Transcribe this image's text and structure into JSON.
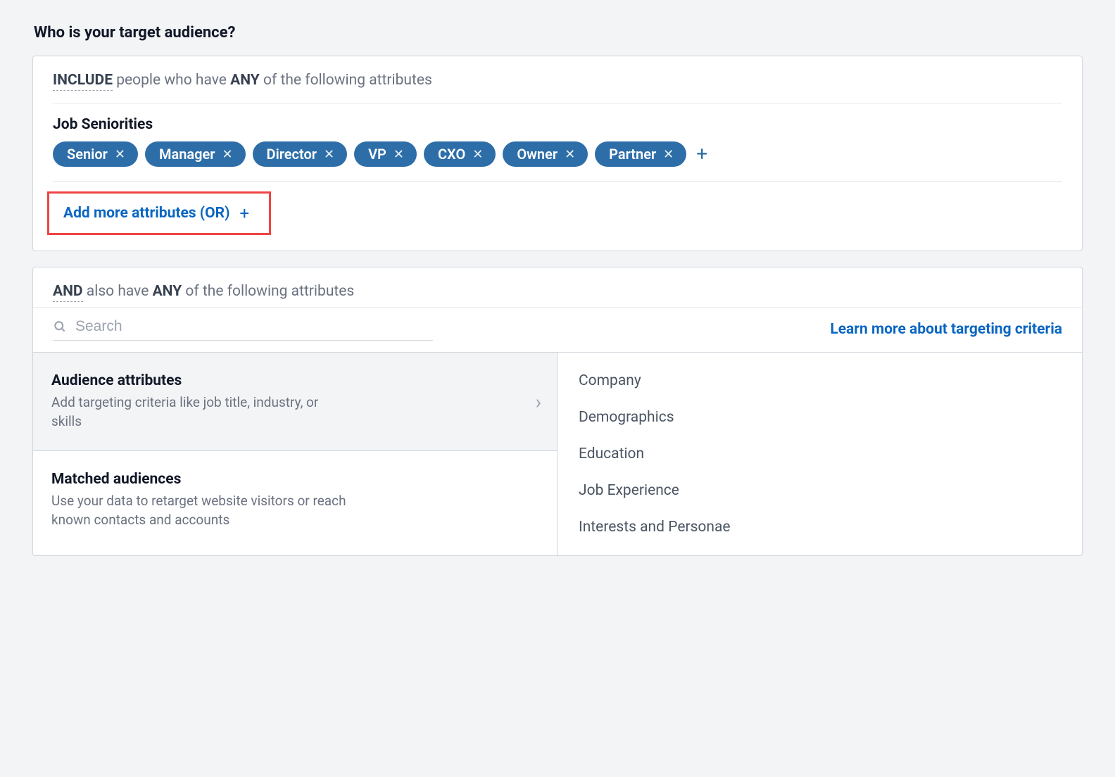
{
  "header": {
    "title": "Who is your target audience?"
  },
  "include_panel": {
    "prefix": "INCLUDE",
    "mid_text": " people who have ",
    "any": "ANY",
    "suffix_text": " of the following attributes",
    "attribute_label": "Job Seniorities",
    "pills": [
      "Senior",
      "Manager",
      "Director",
      "VP",
      "CXO",
      "Owner",
      "Partner"
    ],
    "add_more_label": "Add more attributes (OR)"
  },
  "and_panel": {
    "prefix": "AND",
    "mid_text": " also have ",
    "any": "ANY",
    "suffix_text": " of the following attributes",
    "search_placeholder": "Search",
    "learn_link": "Learn more about targeting criteria",
    "left_cards": [
      {
        "title": "Audience attributes",
        "desc": "Add targeting criteria like job title, industry, or skills",
        "selected": true
      },
      {
        "title": "Matched audiences",
        "desc": "Use your data to retarget website visitors or reach known contacts and accounts",
        "selected": false
      }
    ],
    "categories": [
      "Company",
      "Demographics",
      "Education",
      "Job Experience",
      "Interests and Personae"
    ]
  }
}
